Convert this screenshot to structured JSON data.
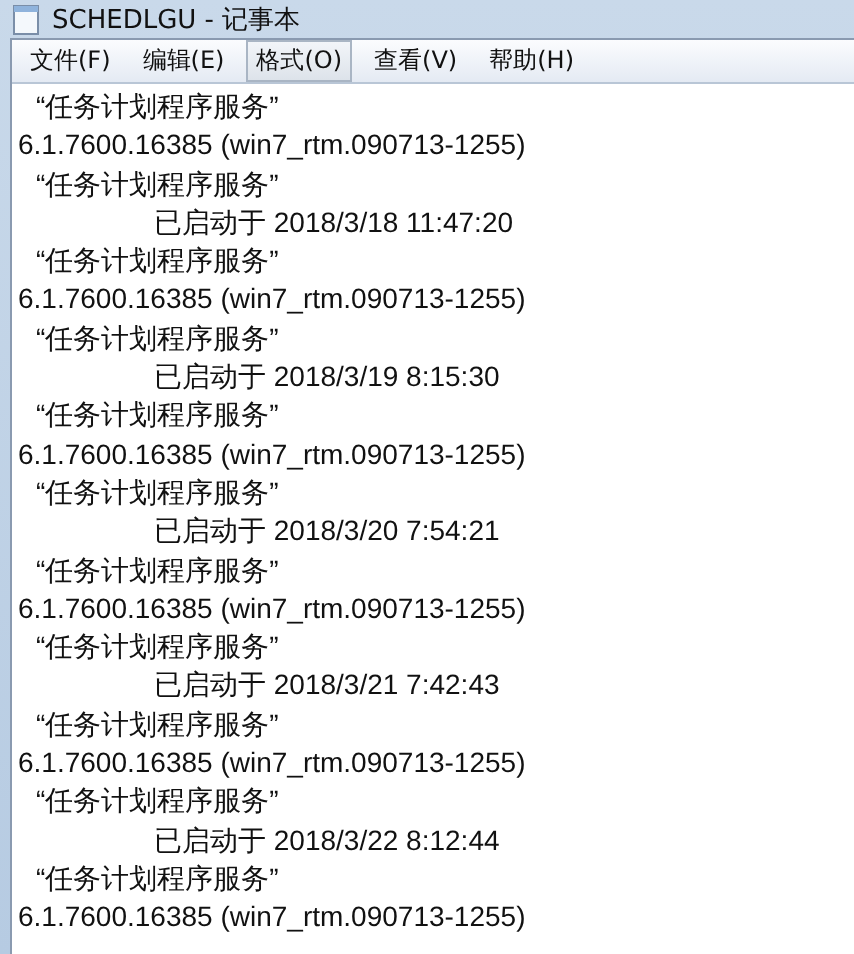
{
  "window": {
    "title": "SCHEDLGU - 记事本"
  },
  "menu": [
    {
      "label": "文件(F)",
      "selected": false
    },
    {
      "label": "编辑(E)",
      "selected": false
    },
    {
      "label": "格式(O)",
      "selected": true
    },
    {
      "label": "查看(V)",
      "selected": false
    },
    {
      "label": "帮助(H)",
      "selected": false
    }
  ],
  "lines": [
    {
      "kind": "quoted",
      "text": "“任务计划程序服务”"
    },
    {
      "kind": "version",
      "text": "6.1.7600.16385 (win7_rtm.090713-1255)"
    },
    {
      "kind": "quoted",
      "text": "“任务计划程序服务”"
    },
    {
      "kind": "started",
      "text": "已启动于 2018/3/18 11:47:20"
    },
    {
      "kind": "quoted",
      "text": "“任务计划程序服务”"
    },
    {
      "kind": "version",
      "text": "6.1.7600.16385 (win7_rtm.090713-1255)"
    },
    {
      "kind": "quoted",
      "text": "“任务计划程序服务”"
    },
    {
      "kind": "started",
      "text": "已启动于 2018/3/19 8:15:30"
    },
    {
      "kind": "quoted",
      "text": "“任务计划程序服务”"
    },
    {
      "kind": "version",
      "text": "6.1.7600.16385 (win7_rtm.090713-1255)"
    },
    {
      "kind": "quoted",
      "text": "“任务计划程序服务”"
    },
    {
      "kind": "started",
      "text": "已启动于 2018/3/20 7:54:21"
    },
    {
      "kind": "quoted",
      "text": "“任务计划程序服务”"
    },
    {
      "kind": "version",
      "text": "6.1.7600.16385 (win7_rtm.090713-1255)"
    },
    {
      "kind": "quoted",
      "text": "“任务计划程序服务”"
    },
    {
      "kind": "started",
      "text": "已启动于 2018/3/21 7:42:43"
    },
    {
      "kind": "quoted",
      "text": "“任务计划程序服务”"
    },
    {
      "kind": "version",
      "text": "6.1.7600.16385 (win7_rtm.090713-1255)"
    },
    {
      "kind": "quoted",
      "text": "“任务计划程序服务”"
    },
    {
      "kind": "started",
      "text": "已启动于 2018/3/22 8:12:44"
    },
    {
      "kind": "quoted",
      "text": "“任务计划程序服务”"
    },
    {
      "kind": "version",
      "text": "6.1.7600.16385 (win7_rtm.090713-1255)"
    }
  ]
}
